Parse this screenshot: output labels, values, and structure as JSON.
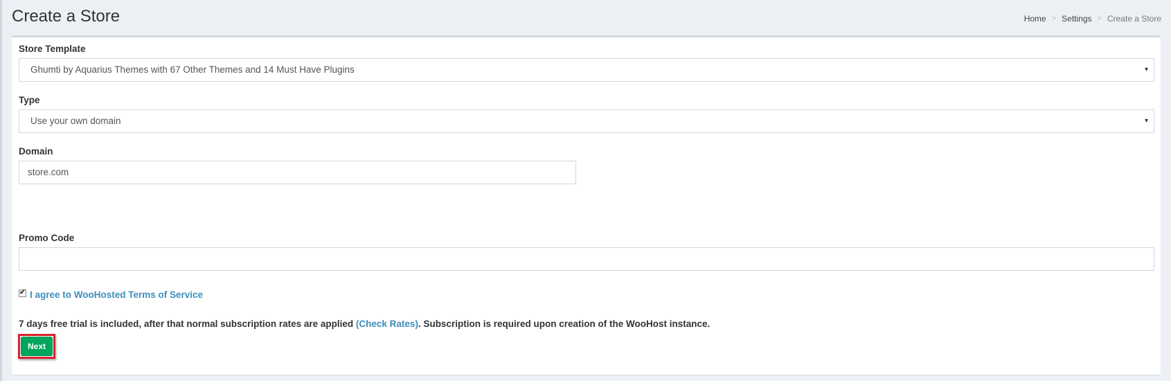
{
  "header": {
    "title": "Create a Store",
    "breadcrumb": {
      "home": "Home",
      "separator": ">",
      "settings": "Settings",
      "current": "Create a Store"
    }
  },
  "form": {
    "store_template": {
      "label": "Store Template",
      "value": "Ghumti by Aquarius Themes with 67 Other Themes and 14 Must Have Plugins"
    },
    "type": {
      "label": "Type",
      "value": "Use your own domain"
    },
    "domain": {
      "label": "Domain",
      "value": "store.com"
    },
    "promo_code": {
      "label": "Promo Code",
      "value": ""
    },
    "terms": {
      "checked": true,
      "label": "I agree to WooHosted Terms of Service"
    },
    "trial_notice": {
      "before": "7 days free trial is included, after that normal subscription rates are applied ",
      "link": "(Check Rates)",
      "after": ". Subscription is required upon creation of the WooHost instance."
    },
    "next_label": "Next"
  },
  "colors": {
    "link": "#3c8dbc",
    "next_button": "#00a65a",
    "highlight_border": "#d9232d",
    "page_background": "#ecf0f5"
  },
  "icons": {
    "select_caret": "▾",
    "checkbox_tick": "✔"
  }
}
